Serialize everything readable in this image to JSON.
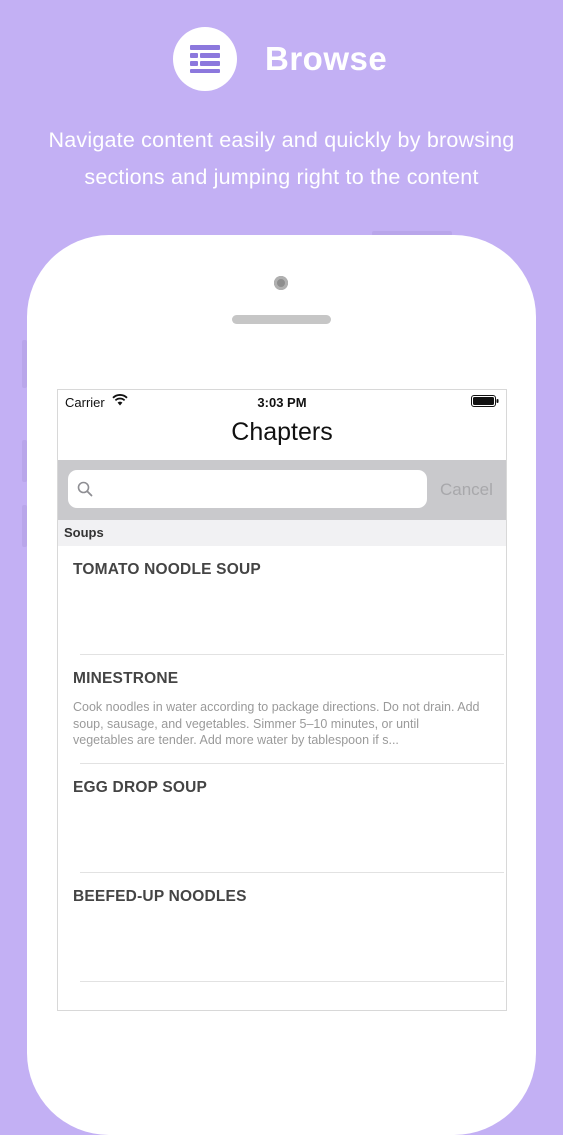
{
  "promo": {
    "title": "Browse",
    "subtitle_line1": "Navigate content easily and quickly by browsing",
    "subtitle_line2": "sections and jumping right to the content",
    "badge_icon": "list-icon"
  },
  "status_bar": {
    "carrier": "Carrier",
    "time": "3:03 PM"
  },
  "nav": {
    "title": "Chapters"
  },
  "search": {
    "placeholder": "",
    "cancel_label": "Cancel"
  },
  "section": {
    "title": "Soups"
  },
  "rows": [
    {
      "title": "TOMATO NOODLE SOUP",
      "desc": ""
    },
    {
      "title": "MINESTRONE",
      "desc": "Cook noodles in water according to package directions. Do not drain. Add soup, sausage, and vegetables. Simmer 5–10 minutes, or until vegetables are tender. Add more water by tablespoon if s..."
    },
    {
      "title": "EGG DROP SOUP",
      "desc": ""
    },
    {
      "title": "BEEFED-UP NOODLES",
      "desc": ""
    }
  ],
  "colors": {
    "background": "#c3b0f4",
    "accent": "#7d68d6"
  }
}
